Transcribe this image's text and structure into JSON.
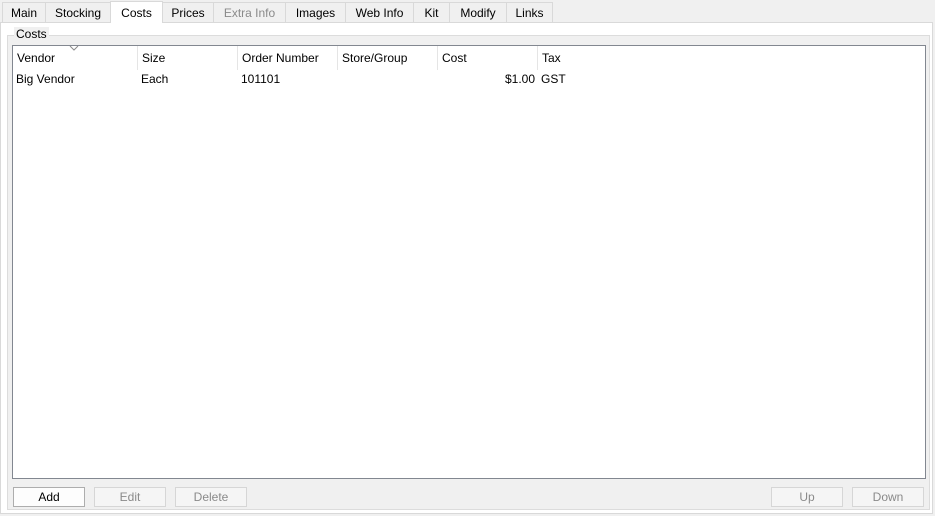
{
  "tabs": [
    {
      "label": "Main",
      "state": "normal"
    },
    {
      "label": "Stocking",
      "state": "normal"
    },
    {
      "label": "Costs",
      "state": "active"
    },
    {
      "label": "Prices",
      "state": "normal"
    },
    {
      "label": "Extra Info",
      "state": "disabled"
    },
    {
      "label": "Images",
      "state": "normal"
    },
    {
      "label": "Web Info",
      "state": "normal"
    },
    {
      "label": "Kit",
      "state": "normal"
    },
    {
      "label": "Modify",
      "state": "normal"
    },
    {
      "label": "Links",
      "state": "normal"
    }
  ],
  "costs_group": {
    "title": "Costs",
    "columns": [
      "Vendor",
      "Size",
      "Order Number",
      "Store/Group",
      "Cost",
      "Tax"
    ],
    "sorted_column": "Vendor",
    "rows": [
      {
        "vendor": "Big Vendor",
        "size": "Each",
        "order_number": "101101",
        "store_group": "",
        "cost": "$1.00",
        "tax": "GST"
      }
    ]
  },
  "buttons": {
    "add": {
      "label": "Add",
      "enabled": true
    },
    "edit": {
      "label": "Edit",
      "enabled": false
    },
    "delete": {
      "label": "Delete",
      "enabled": false
    },
    "up": {
      "label": "Up",
      "enabled": false
    },
    "down": {
      "label": "Down",
      "enabled": false
    }
  },
  "colors": {
    "tab_disabled_text": "#8a8a8a",
    "list_border": "#828790",
    "window_bg": "#f0f0f0"
  }
}
